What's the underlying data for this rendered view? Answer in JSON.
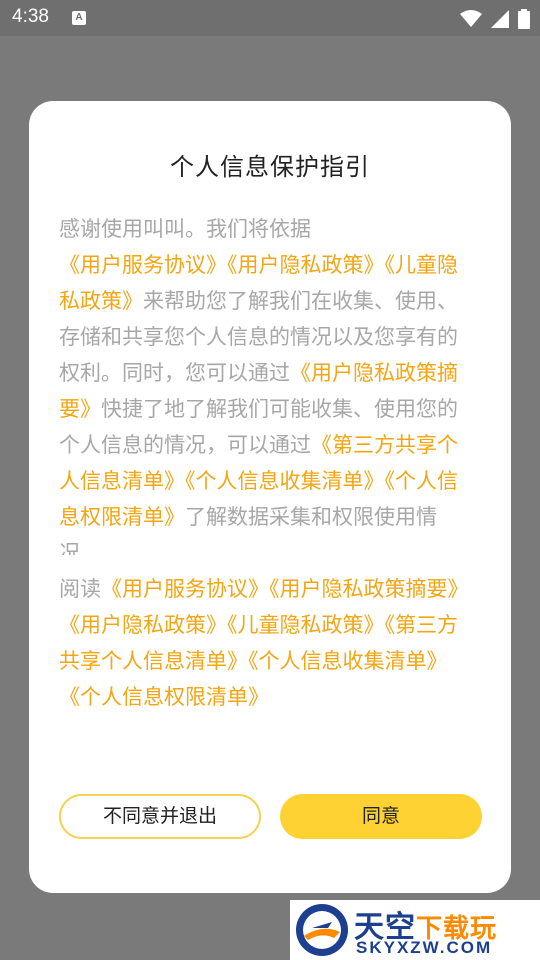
{
  "status_bar": {
    "time": "4:38",
    "notification_icon": "A"
  },
  "dialog": {
    "title": "个人信息保护指引",
    "body_segments": [
      {
        "text": "感谢使用叫叫。我们将依据",
        "link": false
      },
      {
        "text": "《用户服务协议》",
        "link": true
      },
      {
        "text": "《用户隐私政策》",
        "link": true
      },
      {
        "text": "《儿童隐私政策》",
        "link": true
      },
      {
        "text": "来帮助您了解我们在收集、使用、存储和共享您个人信息的情况以及您享有的权利。同时，您可以通过",
        "link": false
      },
      {
        "text": "《用户隐私政策摘要》",
        "link": true
      },
      {
        "text": "快捷了地了解我们可能收集、使用您的个人信息的情况，可以通过",
        "link": false
      },
      {
        "text": "《第三方共享个人信息清单》",
        "link": true
      },
      {
        "text": "《个人信息收集清单》",
        "link": true
      },
      {
        "text": "《个人信息权限清单》",
        "link": true
      },
      {
        "text": "了解数据采集和权限使用情况。",
        "link": false
      }
    ],
    "read_segments": [
      {
        "text": "阅读",
        "link": false
      },
      {
        "text": "《用户服务协议》",
        "link": true
      },
      {
        "text": "《用户隐私政策摘要》",
        "link": true
      },
      {
        "text": "《用户隐私政策》",
        "link": true
      },
      {
        "text": "《儿童隐私政策》",
        "link": true
      },
      {
        "text": "《第三方共享个人信息清单》",
        "link": true
      },
      {
        "text": "《个人信息收集清单》",
        "link": true
      },
      {
        "text": "《个人信息权限清单》",
        "link": true
      }
    ],
    "disagree_label": "不同意并退出",
    "agree_label": "同意"
  },
  "watermark": {
    "title_main": "天空",
    "title_accent": "下载玩",
    "subtitle": "SKYXZW.COM"
  },
  "icons": [
    "wifi-icon",
    "cellular-signal-icon",
    "battery-icon",
    "notification-icon",
    "watermark-logo-icon"
  ],
  "colors": {
    "link": "#f3a512",
    "body_text": "#a7a7a7",
    "agree_button": "#fdd232",
    "disagree_border": "#f6d253",
    "overlay": "#7a7a7a"
  }
}
